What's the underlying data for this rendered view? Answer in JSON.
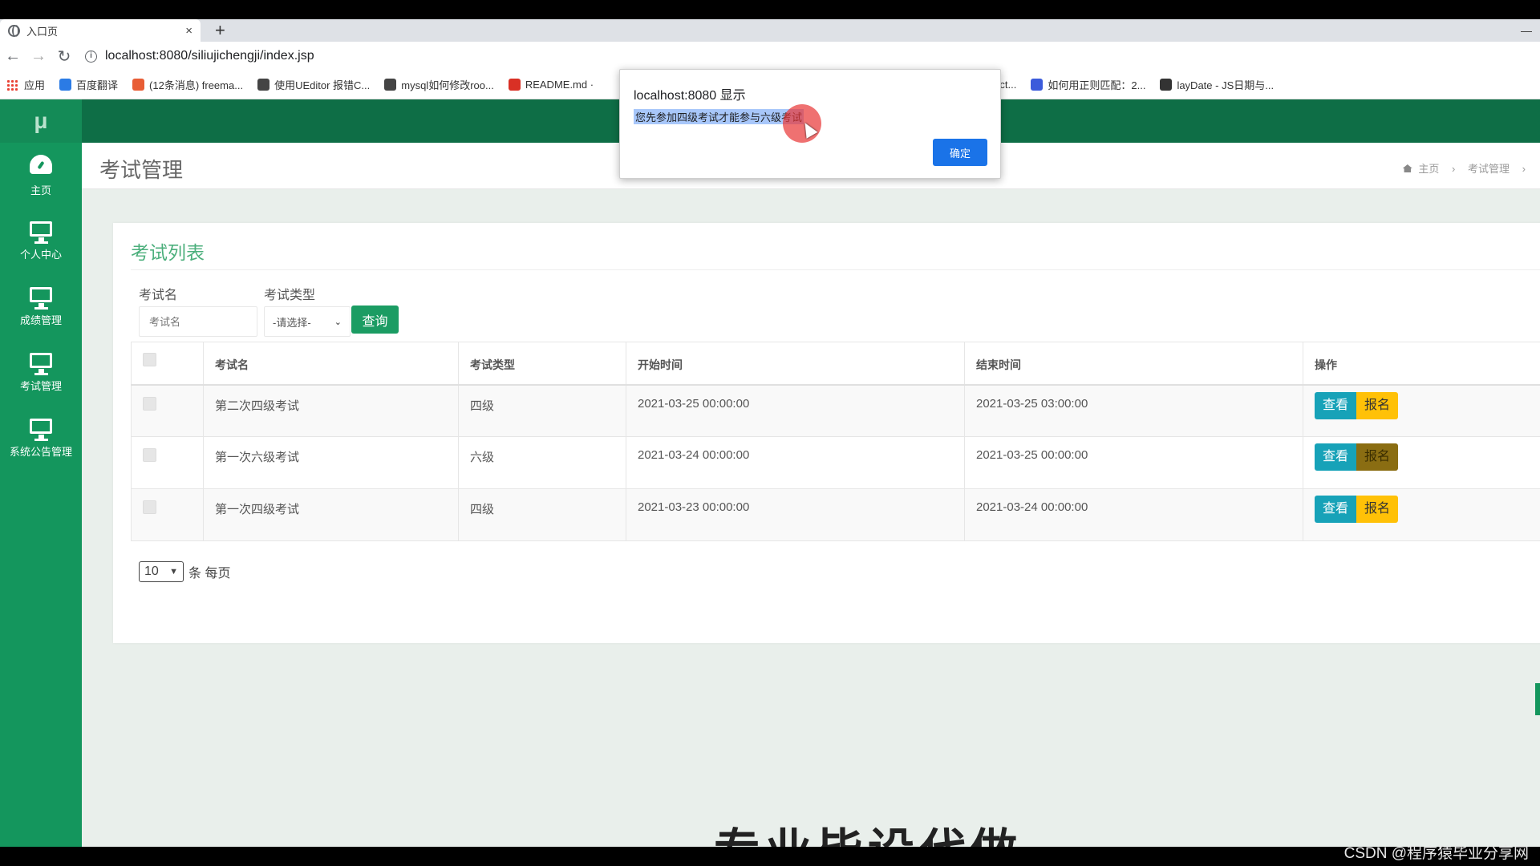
{
  "browser": {
    "tab_title": "入口页",
    "tab_close": "×",
    "new_tab": "+",
    "url": "localhost:8080/siliujichengji/index.jsp",
    "bookmarks": [
      {
        "label": "应用",
        "color": "#e94235"
      },
      {
        "label": "百度翻译",
        "color": "#2b7be5"
      },
      {
        "label": "(12条消息) freema...",
        "color": "#e85d35"
      },
      {
        "label": "使用UEditor 报错C...",
        "color": "#444444"
      },
      {
        "label": "mysql如何修改roo...",
        "color": "#444444"
      },
      {
        "label": "README.md ·",
        "color": "#d93025"
      },
      {
        "label": "elect...",
        "color": "#444444"
      },
      {
        "label": "如何用正则匹配：2...",
        "color": "#3b5bdb"
      },
      {
        "label": "layDate - JS日期与...",
        "color": "#333333"
      }
    ]
  },
  "sidebar": {
    "logo": "μ",
    "items": [
      {
        "label": "主页",
        "icon": "dashboard-icon"
      },
      {
        "label": "个人中心",
        "icon": "monitor-icon"
      },
      {
        "label": "成绩管理",
        "icon": "monitor-icon"
      },
      {
        "label": "考试管理",
        "icon": "monitor-icon"
      },
      {
        "label": "系统公告管理",
        "icon": "monitor-icon"
      }
    ]
  },
  "page": {
    "title": "考试管理",
    "breadcrumb": {
      "home": "主页",
      "current": "考试管理",
      "sep": "›"
    }
  },
  "card": {
    "title": "考试列表",
    "filters": {
      "name_label": "考试名",
      "name_placeholder": "考试名",
      "type_label": "考试类型",
      "type_selected": "-请选择-",
      "query_label": "查询"
    },
    "table": {
      "headers": [
        "考试名",
        "考试类型",
        "开始时间",
        "结束时间",
        "操作"
      ],
      "rows": [
        {
          "name": "第二次四级考试",
          "type": "四级",
          "start": "2021-03-25 00:00:00",
          "end": "2021-03-25 03:00:00"
        },
        {
          "name": "第一次六级考试",
          "type": "六级",
          "start": "2021-03-24 00:00:00",
          "end": "2021-03-25 00:00:00"
        },
        {
          "name": "第一次四级考试",
          "type": "四级",
          "start": "2021-03-23 00:00:00",
          "end": "2021-03-24 00:00:00"
        }
      ],
      "view_label": "查看",
      "signup_label": "报名"
    },
    "page_size": {
      "value": "10",
      "suffix": "条 每页"
    }
  },
  "overlay_text": "专业毕设代做",
  "watermark": "CSDN @程序猿毕业分享网",
  "alert": {
    "title": "localhost:8080 显示",
    "message": "您先参加四级考试才能参与六级考试",
    "ok_label": "确定"
  },
  "colors": {
    "sidebar": "#14965d",
    "header": "#0e6e46",
    "view_button": "#17a2b8",
    "signup_button": "#ffc107",
    "query_button": "#1b9c63",
    "alert_ok": "#1a73e8"
  }
}
